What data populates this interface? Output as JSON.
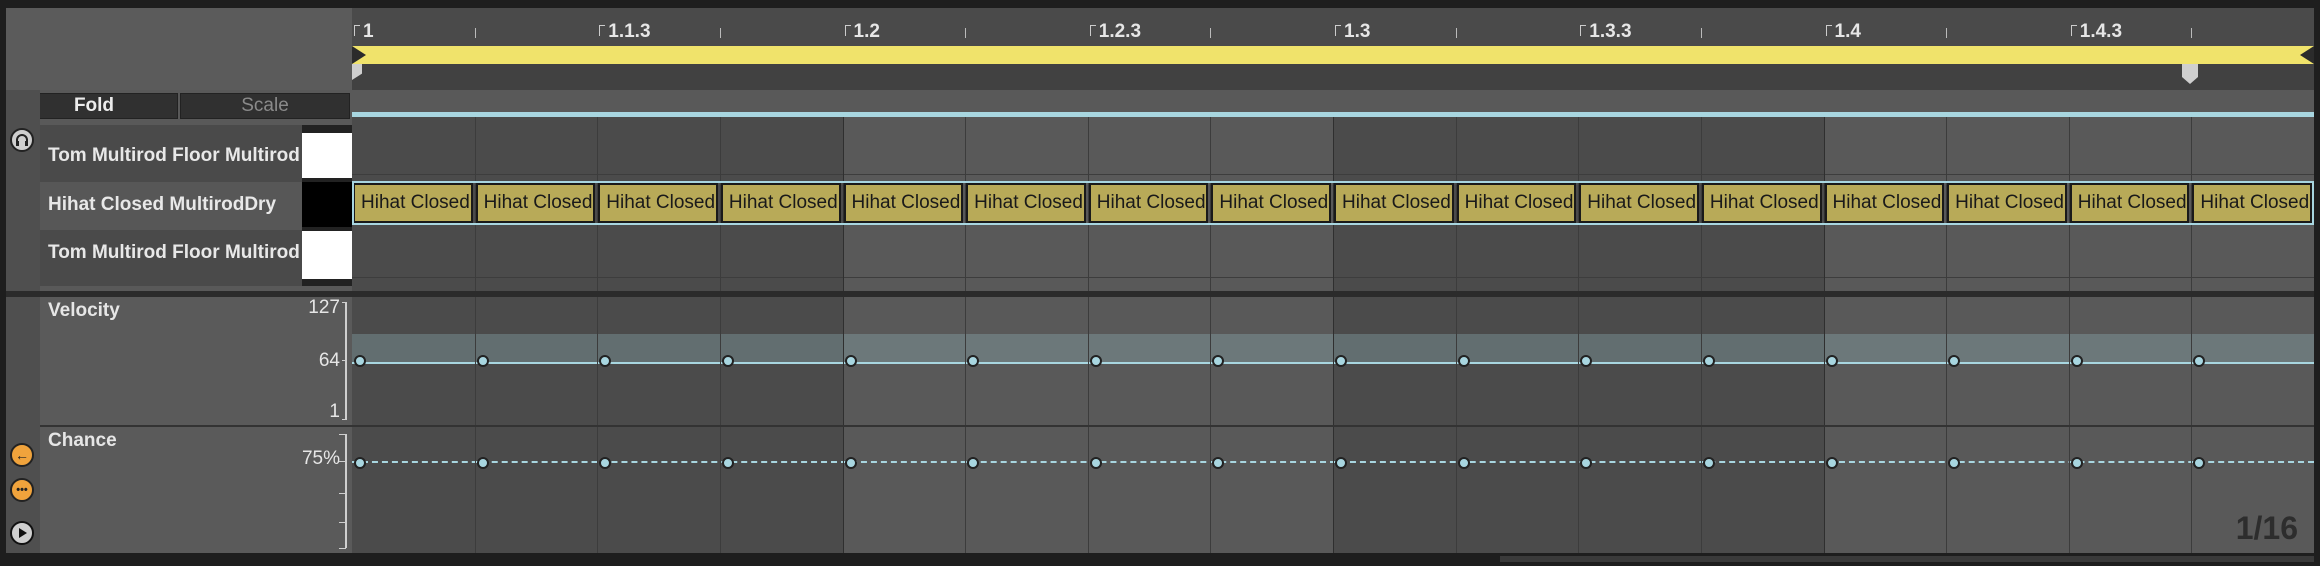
{
  "ruler": {
    "markers": [
      {
        "label": "1"
      },
      {
        "label": "1.1.3"
      },
      {
        "label": "1.2"
      },
      {
        "label": "1.2.3"
      },
      {
        "label": "1.3"
      },
      {
        "label": "1.3.3"
      },
      {
        "label": "1.4"
      },
      {
        "label": "1.4.3"
      }
    ]
  },
  "toolbar": {
    "fold_label": "Fold",
    "scale_label": "Scale"
  },
  "keys": [
    {
      "name": "Tom Multirod Floor Multirod"
    },
    {
      "name": "Hihat Closed MultirodDry"
    },
    {
      "name": "Tom Multirod Floor Multirod"
    }
  ],
  "notes": {
    "label": "Hihat Closed MultirodDry",
    "count": 16
  },
  "velocity": {
    "label": "Velocity",
    "axis": [
      "127",
      "64",
      "1"
    ],
    "values": [
      64,
      64,
      64,
      64,
      64,
      64,
      64,
      64,
      64,
      64,
      64,
      64,
      64,
      64,
      64,
      64
    ]
  },
  "chance": {
    "label": "Chance",
    "axis_label": "75%",
    "values": [
      75,
      75,
      75,
      75,
      75,
      75,
      75,
      75,
      75,
      75,
      75,
      75,
      75,
      75,
      75,
      75
    ]
  },
  "grid_resolution": "1/16",
  "colors": {
    "loop_bar": "#f0e36b",
    "note_fill": "#b8aa58",
    "selection": "#a8d6e0",
    "accent_orange": "#f0a33c"
  },
  "icons": {
    "headphones": "headphones-icon",
    "prev": "arrow-left-icon",
    "more": "more-icon",
    "play": "play-icon"
  }
}
